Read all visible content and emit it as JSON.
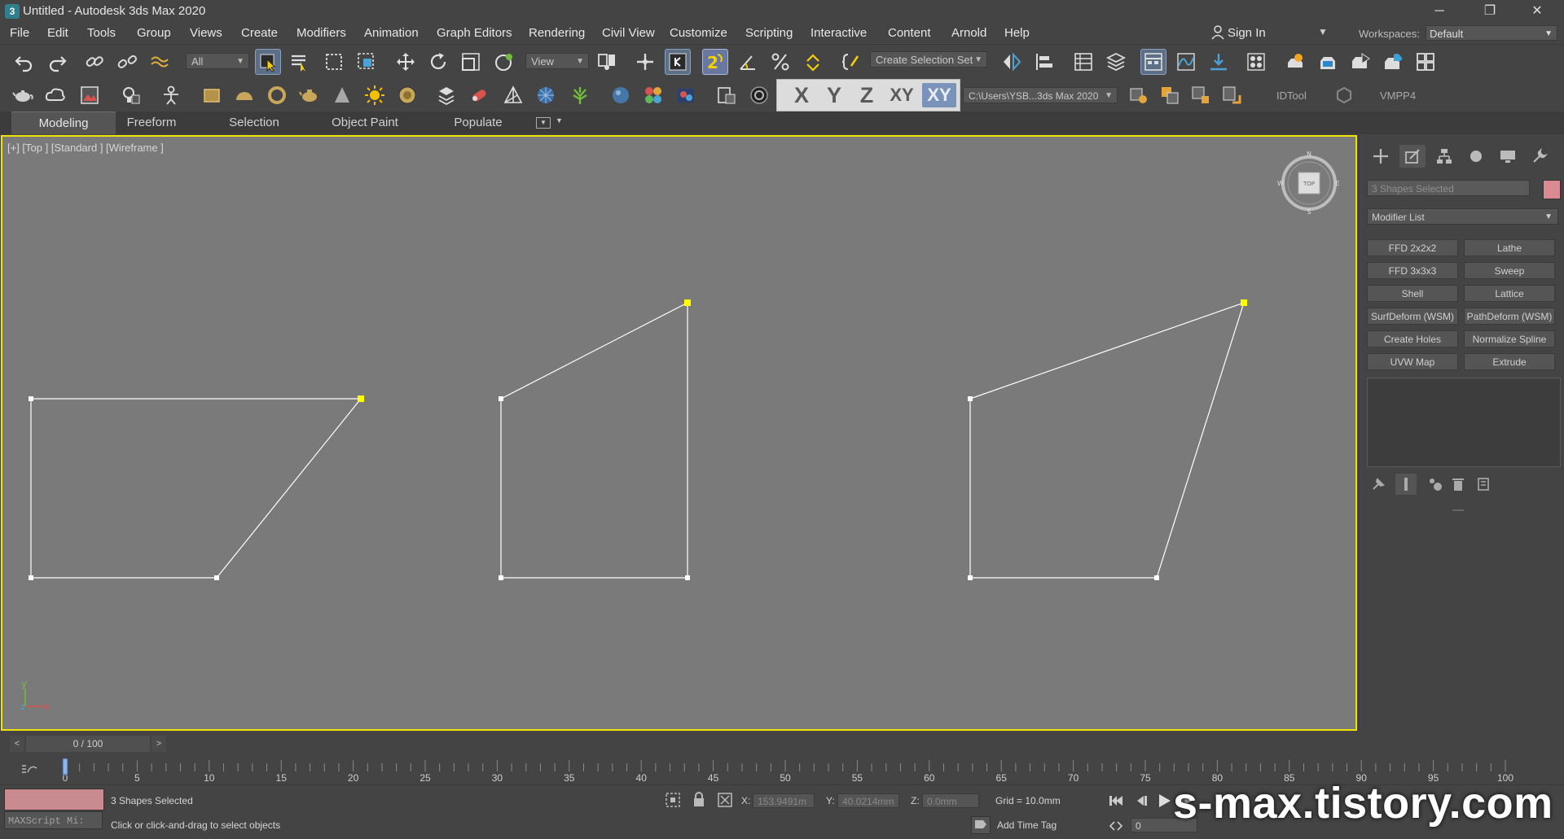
{
  "window": {
    "title": "Untitled - Autodesk 3ds Max 2020",
    "app_icon": "3",
    "controls": {
      "minimize": "─",
      "maximize": "❐",
      "close": "✕"
    }
  },
  "menubar": {
    "items": [
      "File",
      "Edit",
      "Tools",
      "Group",
      "Views",
      "Create",
      "Modifiers",
      "Animation",
      "Graph Editors",
      "Rendering",
      "Civil View",
      "Customize",
      "Scripting",
      "Interactive",
      "Content",
      "Arnold",
      "Help"
    ],
    "sign_in": "Sign In",
    "workspaces_label": "Workspaces:",
    "workspace_value": "Default"
  },
  "toolbar_main": {
    "selection_filter": "All",
    "ref_coord": "View",
    "named_selection": "Create Selection Set",
    "snaps_value": "2"
  },
  "axis_constraints": {
    "x": "X",
    "y": "Y",
    "z": "Z",
    "xy": "XY",
    "xy_active": "XY"
  },
  "toolbar_second": {
    "project_path": "C:\\Users\\YSB...3ds Max 2020",
    "idtool": "IDTool",
    "vmpp4": "VMPP4"
  },
  "ribbon": {
    "tabs": [
      "Modeling",
      "Freeform",
      "Selection",
      "Object Paint",
      "Populate"
    ],
    "active_tab": "Modeling"
  },
  "viewport": {
    "label": "[+] [Top ] [Standard ] [Wireframe ]",
    "viewcube_face": "TOP",
    "compass": {
      "n": "N",
      "s": "S",
      "e": "E",
      "w": "W"
    },
    "axis_tripod": {
      "x": "x",
      "y": "y",
      "z": "z"
    }
  },
  "command_panel": {
    "object_name": "3 Shapes Selected",
    "modifier_list": "Modifier List",
    "modifier_buttons": [
      [
        "FFD 2x2x2",
        "Lathe"
      ],
      [
        "FFD 3x3x3",
        "Sweep"
      ],
      [
        "Shell",
        "Lattice"
      ],
      [
        "SurfDeform (WSM)",
        "PathDeform (WSM)"
      ],
      [
        "Create Holes",
        "Normalize Spline"
      ],
      [
        "UVW Map",
        "Extrude"
      ]
    ]
  },
  "time_slider": {
    "value": "0 / 100",
    "prev": "<",
    "next": ">"
  },
  "trackbar": {
    "ticks": [
      "0",
      "5",
      "10",
      "15",
      "20",
      "25",
      "30",
      "35",
      "40",
      "45",
      "50",
      "55",
      "60",
      "65",
      "70",
      "75",
      "80",
      "85",
      "90",
      "95",
      "100"
    ],
    "current_frame": 0
  },
  "status": {
    "maxscript": "MAXScript Mi:",
    "selection": "3 Shapes Selected",
    "prompt": "Click or click-and-drag to select objects",
    "x_label": "X:",
    "x_value": "153.9491m",
    "y_label": "Y:",
    "y_value": "40.0214mm",
    "z_label": "Z:",
    "z_value": "0.0mm",
    "grid": "Grid = 10.0mm",
    "add_time_tag": "Add Time Tag",
    "frame_field": "0"
  },
  "watermark": "s-max.tistory.com",
  "colors": {
    "viewport_bg": "#7a7a7a",
    "viewport_border": "#f0e100",
    "ui_bg": "#444444",
    "active_button": "#5d6f87",
    "axis_highlight": "#7c93b9",
    "object_color": "#d98a92",
    "shape_line": "#ffffff",
    "selected_vertex": "#ffff00"
  }
}
